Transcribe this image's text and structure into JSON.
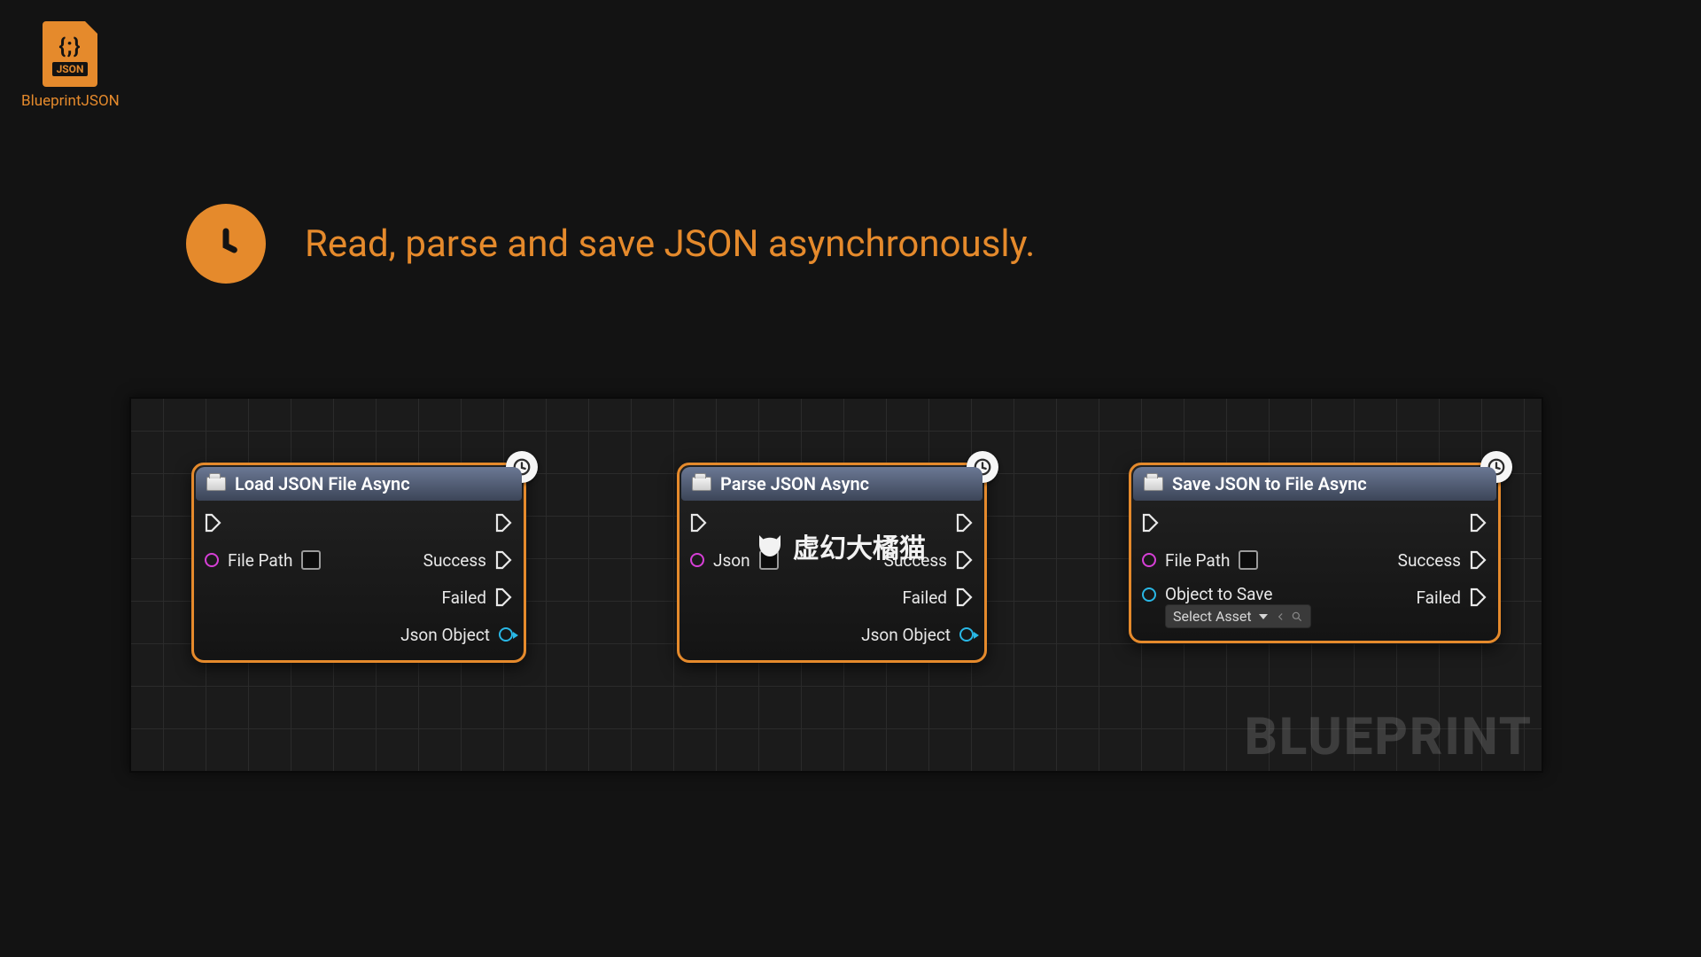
{
  "desktop_icon": {
    "braces": "{;}",
    "tag": "JSON",
    "label": "BlueprintJSON"
  },
  "headline": "Read, parse and save JSON asynchronously.",
  "canvas": {
    "brand_watermark": "BLUEPRINT",
    "video_watermark": "虚幻大橘猫"
  },
  "nodes": [
    {
      "title": "Load JSON File Async",
      "inputs": [
        {
          "type": "exec"
        },
        {
          "type": "data",
          "label": "File Path",
          "pinColor": "magenta",
          "hasTextbox": true
        }
      ],
      "outputs": [
        {
          "type": "exec"
        },
        {
          "type": "exec",
          "label": "Success"
        },
        {
          "type": "exec",
          "label": "Failed"
        },
        {
          "type": "data",
          "label": "Json Object",
          "pinColor": "cyan"
        }
      ]
    },
    {
      "title": "Parse JSON Async",
      "inputs": [
        {
          "type": "exec"
        },
        {
          "type": "data",
          "label": "Json",
          "pinColor": "magenta",
          "hasTextbox": true
        }
      ],
      "outputs": [
        {
          "type": "exec"
        },
        {
          "type": "exec",
          "label": "Success"
        },
        {
          "type": "exec",
          "label": "Failed"
        },
        {
          "type": "data",
          "label": "Json Object",
          "pinColor": "cyan"
        }
      ]
    },
    {
      "title": "Save JSON to File Async",
      "inputs": [
        {
          "type": "exec"
        },
        {
          "type": "data",
          "label": "File Path",
          "pinColor": "magenta",
          "hasTextbox": true
        },
        {
          "type": "asset",
          "label": "Object to Save",
          "pinColor": "cyan",
          "picker": "Select Asset"
        }
      ],
      "outputs": [
        {
          "type": "exec"
        },
        {
          "type": "exec",
          "label": "Success"
        },
        {
          "type": "exec",
          "label": "Failed"
        }
      ]
    }
  ]
}
